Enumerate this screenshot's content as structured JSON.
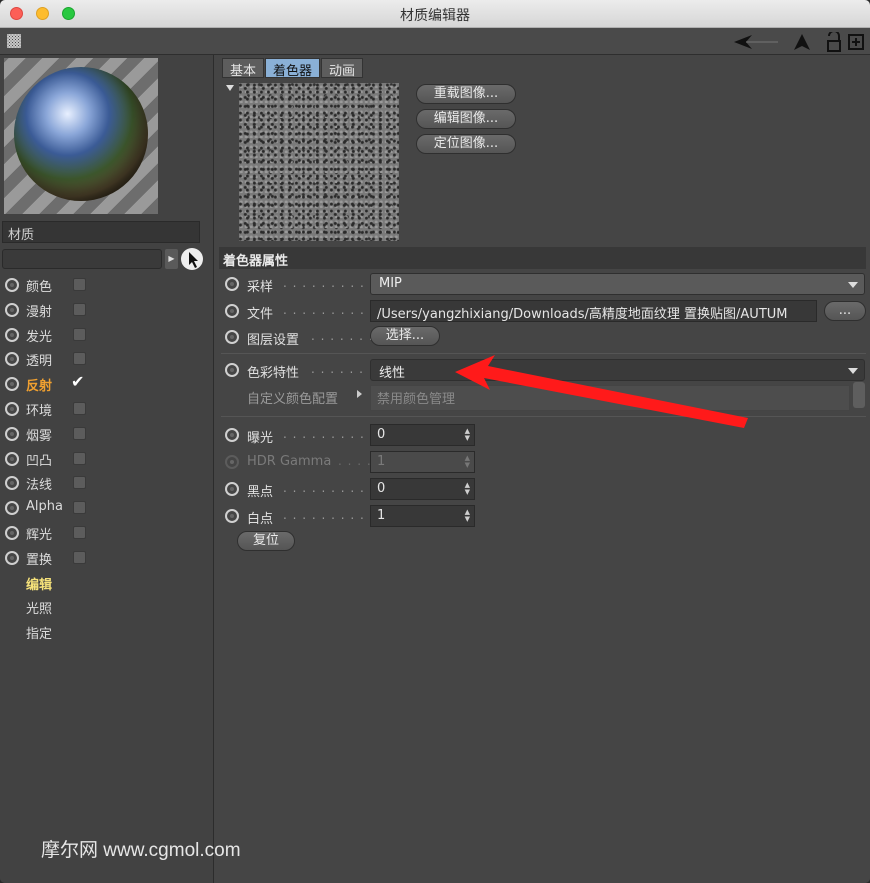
{
  "window": {
    "title": "材质编辑器"
  },
  "material": {
    "name": "材质"
  },
  "channels": [
    {
      "label": "颜色",
      "has_checkbox": true,
      "checked": false,
      "style": "normal"
    },
    {
      "label": "漫射",
      "has_checkbox": true,
      "checked": false,
      "style": "normal"
    },
    {
      "label": "发光",
      "has_checkbox": true,
      "checked": false,
      "style": "normal"
    },
    {
      "label": "透明",
      "has_checkbox": true,
      "checked": false,
      "style": "normal"
    },
    {
      "label": "反射",
      "has_checkbox": true,
      "checked": true,
      "style": "active"
    },
    {
      "label": "环境",
      "has_checkbox": true,
      "checked": false,
      "style": "normal"
    },
    {
      "label": "烟雾",
      "has_checkbox": true,
      "checked": false,
      "style": "normal"
    },
    {
      "label": "凹凸",
      "has_checkbox": true,
      "checked": false,
      "style": "normal"
    },
    {
      "label": "法线",
      "has_checkbox": true,
      "checked": false,
      "style": "normal"
    },
    {
      "label": "Alpha",
      "has_checkbox": true,
      "checked": false,
      "style": "normal"
    },
    {
      "label": "辉光",
      "has_checkbox": true,
      "checked": false,
      "style": "normal"
    },
    {
      "label": "置换",
      "has_checkbox": true,
      "checked": false,
      "style": "normal"
    },
    {
      "label": "编辑",
      "has_checkbox": false,
      "checked": false,
      "style": "yellow"
    },
    {
      "label": "光照",
      "has_checkbox": false,
      "checked": false,
      "style": "normal"
    },
    {
      "label": "指定",
      "has_checkbox": false,
      "checked": false,
      "style": "normal"
    }
  ],
  "tabs": [
    {
      "label": "基本",
      "active": false
    },
    {
      "label": "着色器",
      "active": true
    },
    {
      "label": "动画",
      "active": false
    }
  ],
  "image_buttons": {
    "reload": "重载图像...",
    "edit": "编辑图像...",
    "locate": "定位图像..."
  },
  "shader": {
    "section_title": "着色器属性",
    "sampling": {
      "label": "采样",
      "value": "MIP"
    },
    "file": {
      "label": "文件",
      "value": "/Users/yangzhixiang/Downloads/高精度地面纹理 置换贴图/AUTUM",
      "browse": "..."
    },
    "layer": {
      "label": "图层设置",
      "button": "选择..."
    },
    "color_profile": {
      "label": "色彩特性",
      "value": "线性"
    },
    "custom_profile": {
      "label": "自定义颜色配置",
      "value": "禁用颜色管理"
    },
    "exposure": {
      "label": "曝光",
      "value": "0"
    },
    "hdr_gamma": {
      "label": "HDR Gamma",
      "value": "1"
    },
    "black_point": {
      "label": "黑点",
      "value": "0"
    },
    "white_point": {
      "label": "白点",
      "value": "1"
    },
    "reset": "复位"
  },
  "watermark": "摩尔网 www.cgmol.com",
  "icons": [
    "grid-icon",
    "back-arrow-icon",
    "pointer-icon",
    "lock-icon",
    "new-window-icon",
    "cursor-icon"
  ],
  "colors": {
    "accent_tab": "#8ab0d6",
    "active_channel": "#f0a030",
    "edit_channel": "#f6e27a",
    "annotation_arrow": "#ff1a1a"
  }
}
